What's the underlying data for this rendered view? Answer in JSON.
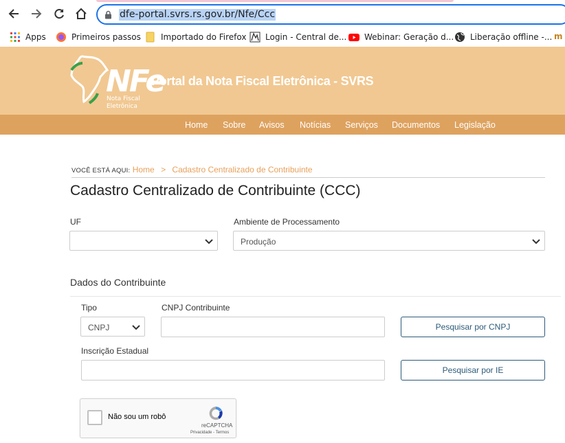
{
  "browser": {
    "url": "dfe-portal.svrs.rs.gov.br/Nfe/Ccc",
    "bookmarks": [
      {
        "label": "Apps",
        "icon": "apps-grid-icon"
      },
      {
        "label": "Primeiros passos",
        "icon": "firefox-icon"
      },
      {
        "label": "Importado do Firefox",
        "icon": "folder-icon"
      },
      {
        "label": "Login - Central de...",
        "icon": "ms-logo-icon"
      },
      {
        "label": "Webinar: Geração d...",
        "icon": "youtube-icon"
      },
      {
        "label": "Liberação offline -...",
        "icon": "globe-icon"
      }
    ]
  },
  "header": {
    "logo_text": "NFe",
    "logo_sub1": "Nota Fiscal",
    "logo_sub2": "Eletrônica",
    "site_title": "Portal da Nota Fiscal Eletrônica - SVRS"
  },
  "nav": [
    "Home",
    "Sobre",
    "Avisos",
    "Notícias",
    "Serviços",
    "Documentos",
    "Legislação"
  ],
  "breadcrumb": {
    "prefix": "VOCÊ ESTÁ AQUI:",
    "home": "Home",
    "separator": ">",
    "current": "Cadastro Centralizado de Contribuinte"
  },
  "page_title": "Cadastro Centralizado de Contribuinte (CCC)",
  "filters": {
    "uf_label": "UF",
    "uf_value": "",
    "ambiente_label": "Ambiente de Processamento",
    "ambiente_value": "Produção"
  },
  "dados": {
    "section_title": "Dados do Contribuinte",
    "tipo_label": "Tipo",
    "tipo_value": "CNPJ",
    "cnpj_label": "CNPJ Contribuinte",
    "cnpj_value": "",
    "ie_label": "Inscrição Estadual",
    "ie_value": "",
    "btn_cnpj": "Pesquisar por CNPJ",
    "btn_ie": "Pesquisar por IE"
  },
  "captcha": {
    "label": "Não sou um robô",
    "brand": "reCAPTCHA",
    "terms": "Privacidade - Termos"
  },
  "colors": {
    "header_bg": "#f1c892",
    "nav_bg": "#dea25f",
    "accent_link": "#e8a05a",
    "button_border": "#2c5a79"
  }
}
